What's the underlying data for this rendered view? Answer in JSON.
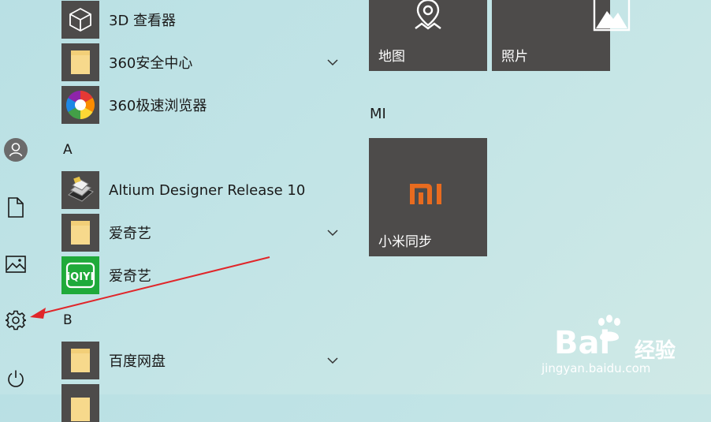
{
  "apps": [
    {
      "label": "3D 查看器",
      "icon": "cube-icon",
      "expandable": false
    },
    {
      "label": "360安全中心",
      "icon": "folder-icon",
      "expandable": true
    },
    {
      "label": "360极速浏览器",
      "icon": "360-browser-icon",
      "expandable": false
    },
    {
      "label": "Altium Designer Release 10",
      "icon": "altium-icon",
      "expandable": false
    },
    {
      "label": "爱奇艺",
      "icon": "folder-icon",
      "expandable": true
    },
    {
      "label": "爱奇艺",
      "icon": "iqiyi-icon",
      "expandable": false
    },
    {
      "label": "百度网盘",
      "icon": "folder-icon",
      "expandable": true
    }
  ],
  "sections": {
    "a": "A",
    "b": "B"
  },
  "tiles": {
    "maps": "地图",
    "photos": "照片",
    "group_title": "MI",
    "xiaomi_sync": "小米同步"
  },
  "watermark": {
    "brand": "Bai",
    "brand2": "经验",
    "url": "jingyan.baidu.com"
  },
  "colors": {
    "tile": "#4d4b4a",
    "mi_orange": "#e86b1f",
    "folder": "#f7d98c",
    "arrow": "#e0262a"
  }
}
